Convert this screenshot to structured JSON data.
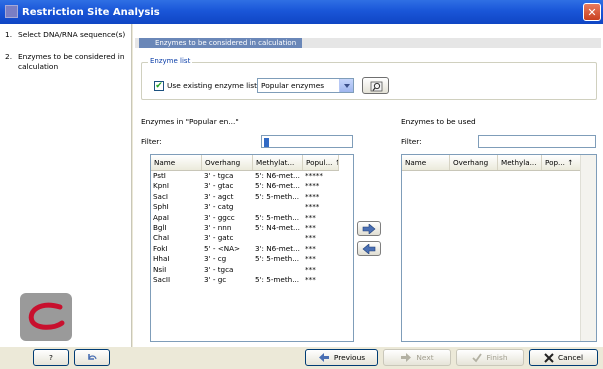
{
  "window": {
    "title": "Restriction Site Analysis",
    "close_glyph": "✕"
  },
  "steps": [
    {
      "num": "1.",
      "label": "Select DNA/RNA sequence(s)"
    },
    {
      "num": "2.",
      "label": "Enzymes to be considered in calculation"
    }
  ],
  "section": {
    "title": "Enzymes to be considered in calculation"
  },
  "enzyme_list": {
    "legend": "Enzyme list",
    "use_existing_label": "Use existing enzyme list",
    "use_existing_checked": true,
    "selected_list": "Popular enzymes",
    "browse_icon": "folder-search-icon"
  },
  "left_panel": {
    "title": "Enzymes in \"Popular en...\"",
    "filter_label": "Filter:",
    "filter_value": "",
    "columns": [
      "Name",
      "Overhang",
      "Methylat...",
      "Popul... ↑"
    ],
    "rows": [
      [
        "PstI",
        "3' - tgca",
        "5': N6-met...",
        "*****"
      ],
      [
        "KpnI",
        "3' - gtac",
        "5': N6-met...",
        "****"
      ],
      [
        "SacI",
        "3' - agct",
        "5': 5-meth...",
        "****"
      ],
      [
        "SphI",
        "3' - catg",
        "",
        "****"
      ],
      [
        "ApaI",
        "3' - ggcc",
        "5': 5-meth...",
        "***"
      ],
      [
        "BglI",
        "3' - nnn",
        "5': N4-met...",
        "***"
      ],
      [
        "ChaI",
        "3' - gatc",
        "",
        "***"
      ],
      [
        "FokI",
        "5' - <NA>",
        "3': N6-met...",
        "***"
      ],
      [
        "HhaI",
        "3' - cg",
        "5': 5-meth...",
        "***"
      ],
      [
        "NsiI",
        "3' - tgca",
        "",
        "***"
      ],
      [
        "SacII",
        "3' - gc",
        "5': 5-meth...",
        "***"
      ]
    ]
  },
  "right_panel": {
    "title": "Enzymes to be used",
    "filter_label": "Filter:",
    "filter_value": "",
    "columns": [
      "Name",
      "Overhang",
      "Methyla...",
      "Pop... ↑"
    ],
    "rows": []
  },
  "transfer": {
    "add_icon": "arrow-right-icon",
    "remove_icon": "arrow-left-icon"
  },
  "footer": {
    "help_label": "?",
    "previous_label": "Previous",
    "next_label": "Next",
    "finish_label": "Finish",
    "cancel_label": "Cancel"
  }
}
